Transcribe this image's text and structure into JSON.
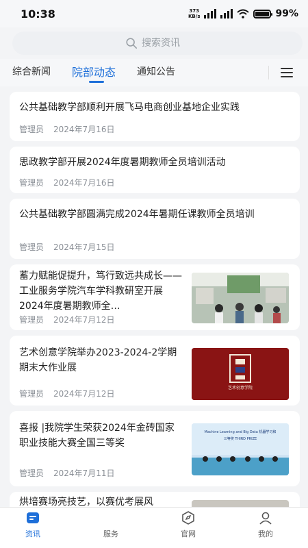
{
  "status_bar": {
    "time": "10:38",
    "net_speed_value": "373",
    "net_speed_unit": "KB/s",
    "battery": "99%",
    "battery_level": 0.99
  },
  "search": {
    "placeholder": "搜索资讯"
  },
  "tabs": [
    {
      "label": "综合新闻",
      "active": false
    },
    {
      "label": "院部动态",
      "active": true
    },
    {
      "label": "通知公告",
      "active": false
    }
  ],
  "articles": [
    {
      "title": "公共基础教学部顺利开展飞马电商创业基地企业实践",
      "author": "管理员",
      "date": "2024年7月16日",
      "has_image": false
    },
    {
      "title": "思政教学部开展2024年度暑期教师全员培训活动",
      "author": "管理员",
      "date": "2024年7月16日",
      "has_image": false
    },
    {
      "title": "公共基础教学部圆满完成2024年暑期任课教师全员培训",
      "author": "管理员",
      "date": "2024年7月15日",
      "has_image": false
    },
    {
      "title": "蓄力赋能促提升，笃行致远共成长——工业服务学院汽车学科教研室开展2024年度暑期教师全…",
      "author": "管理员",
      "date": "2024年7月12日",
      "has_image": true,
      "image": "classroom-photo"
    },
    {
      "title": "艺术创意学院举办2023-2024-2学期期末大作业展",
      "author": "管理员",
      "date": "2024年7月12日",
      "has_image": true,
      "image": "exhibition-banner-photo",
      "image_text": "艺术创意学院"
    },
    {
      "title": "喜报 |我院学生荣获2024年金砖国家职业技能大赛全国三等奖",
      "author": "管理员",
      "date": "2024年7月11日",
      "has_image": true,
      "image": "award-ceremony-photo",
      "image_text_1": "Machine Learning and Big Data 机器学习和",
      "image_text_2": "三等奖 THIRD PRIZE"
    },
    {
      "title": "烘培赛场亮技艺，以赛优考展风",
      "author": "",
      "date": "",
      "has_image": true,
      "image": "partial-photo"
    }
  ],
  "bottom_nav": [
    {
      "label": "资讯",
      "icon": "news-icon",
      "active": true
    },
    {
      "label": "服务",
      "icon": "service-icon",
      "active": false
    },
    {
      "label": "官网",
      "icon": "website-icon",
      "active": false
    },
    {
      "label": "我的",
      "icon": "profile-icon",
      "active": false
    }
  ],
  "colors": {
    "accent": "#1e6fd9",
    "background": "#f3f4f6",
    "meta_text": "#8a8f96"
  }
}
